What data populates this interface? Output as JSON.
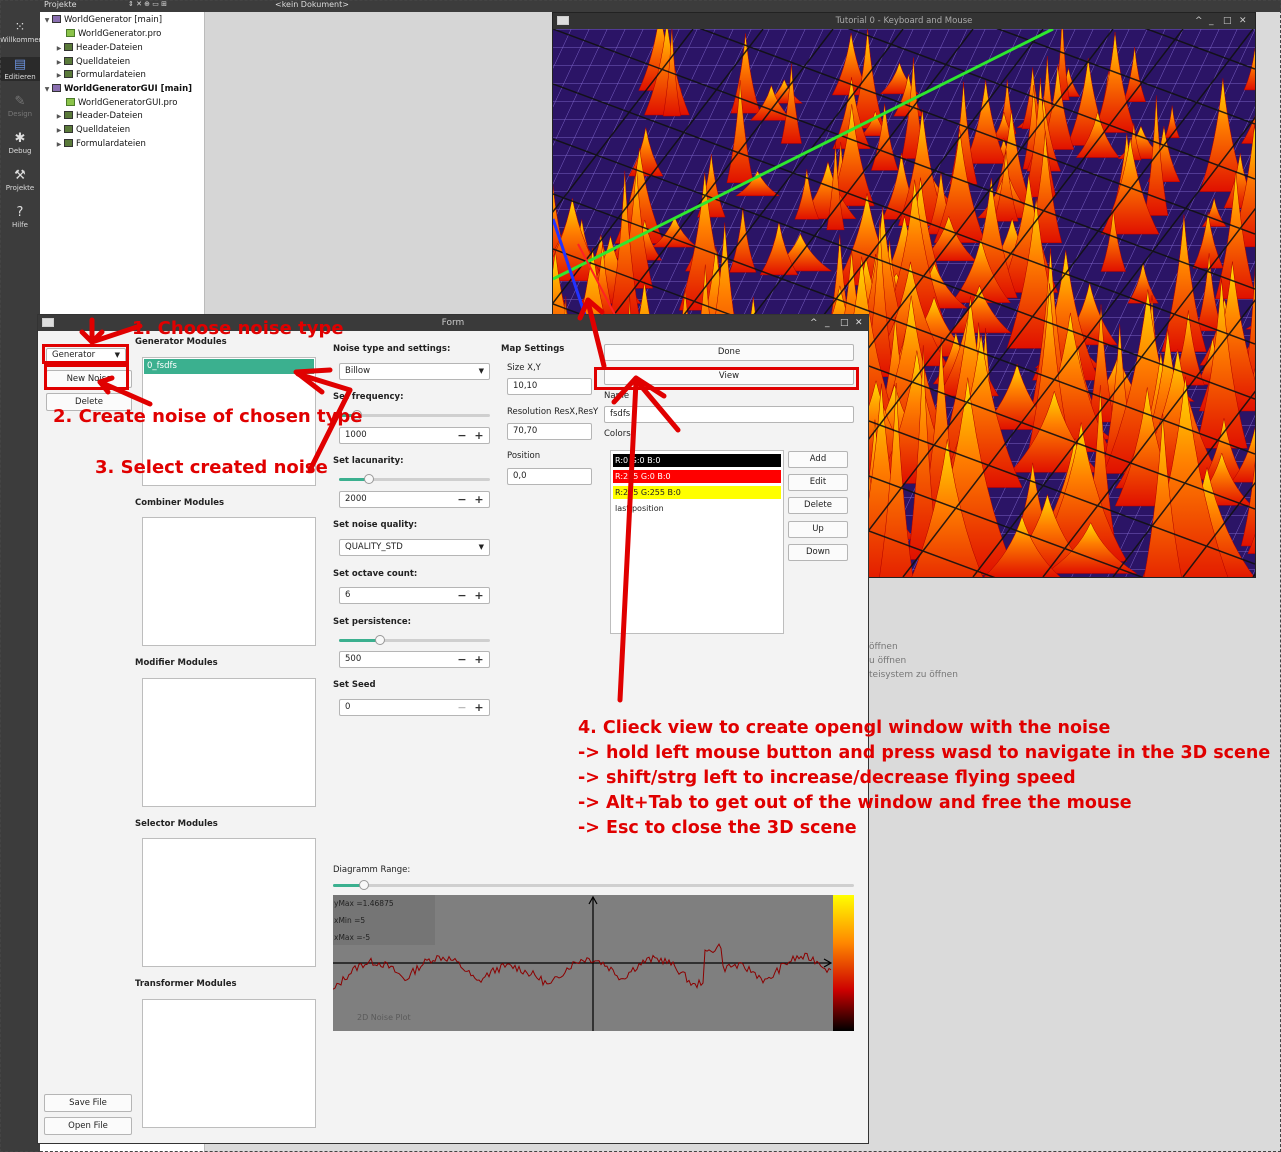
{
  "ide": {
    "topbar": {
      "projects_label": "Projekte",
      "document_label": "<kein Dokument>"
    },
    "modes": [
      {
        "icon": "grid-icon",
        "label": "Willkommen"
      },
      {
        "icon": "edit-icon",
        "label": "Editieren"
      },
      {
        "icon": "pen-icon",
        "label": "Design"
      },
      {
        "icon": "bug-icon",
        "label": "Debug"
      },
      {
        "icon": "wrench-icon",
        "label": "Projekte"
      },
      {
        "icon": "help-icon",
        "label": "Hilfe"
      }
    ],
    "tree": [
      {
        "text": "WorldGenerator [main]",
        "level": 0,
        "bold": false,
        "kind": "root"
      },
      {
        "text": "WorldGenerator.pro",
        "level": 1,
        "kind": "pro"
      },
      {
        "text": "Header-Dateien",
        "level": 1,
        "kind": "folder"
      },
      {
        "text": "Quelldateien",
        "level": 1,
        "kind": "folder"
      },
      {
        "text": "Formulardateien",
        "level": 1,
        "kind": "folder"
      },
      {
        "text": "WorldGeneratorGUI [main]",
        "level": 0,
        "bold": true,
        "kind": "root"
      },
      {
        "text": "WorldGeneratorGUI.pro",
        "level": 1,
        "kind": "pro"
      },
      {
        "text": "Header-Dateien",
        "level": 1,
        "kind": "folder"
      },
      {
        "text": "Quelldateien",
        "level": 1,
        "kind": "folder"
      },
      {
        "text": "Formulardateien",
        "level": 1,
        "kind": "folder"
      }
    ],
    "hints": [
      "öffnen",
      "u öffnen",
      "teisystem zu öffnen"
    ]
  },
  "gl_window": {
    "title": "Tutorial 0 - Keyboard and Mouse"
  },
  "form": {
    "title": "Form",
    "type_combo": "Generator",
    "new_noise": "New Noise",
    "delete": "Delete",
    "save_file": "Save File",
    "open_file": "Open File",
    "generator_modules": "Generator Modules",
    "generator_items": [
      "0_fsdfs"
    ],
    "combiner_modules": "Combiner Modules",
    "modifier_modules": "Modifier Modules",
    "selector_modules": "Selector Modules",
    "transformer_modules": "Transformer Modules",
    "noise_settings": "Noise type and settings:",
    "noise_type": "Billow",
    "set_frequency": "Set frequency:",
    "frequency_value": "1000",
    "frequency_level": 0.12,
    "set_lacunarity": "Set lacunarity:",
    "lacunarity_value": "2000",
    "lacunarity_level": 0.2,
    "set_quality": "Set noise quality:",
    "quality_value": "QUALITY_STD",
    "set_octave": "Set octave count:",
    "octave_value": "6",
    "set_persistence": "Set persistence:",
    "persistence_value": "500",
    "persistence_level": 0.27,
    "set_seed": "Set Seed",
    "seed_value": "0",
    "map_settings": "Map Settings",
    "size_label": "Size X,Y",
    "size_value": "10,10",
    "resolution_label": "Resolution ResX,ResY",
    "resolution_value": "70,70",
    "position_label": "Position",
    "position_value": "0,0",
    "done": "Done",
    "view": "View",
    "name_label": "Name",
    "name_value": "fsdfs",
    "colors_label": "Colors:",
    "colors": [
      {
        "text": "R:0 G:0 B:0",
        "bg": "#000000",
        "fg": "#ffffff"
      },
      {
        "text": "R:255 G:0 B:0",
        "bg": "#ff0000",
        "fg": "#ffffff"
      },
      {
        "text": "R:255 G:255 B:0",
        "bg": "#ffff00",
        "fg": "#222222"
      },
      {
        "text": "last position",
        "bg": "#ffffff",
        "fg": "#222222"
      }
    ],
    "color_buttons": [
      "Add",
      "Edit",
      "Delete",
      "Up",
      "Down"
    ],
    "diagram_range": "Diagramm Range:",
    "diagram_level": 0.06,
    "plot": {
      "ymax": "yMax =1.46875",
      "xmin": "xMin =5",
      "xmax": "xMax =-5",
      "label": "2D Noise Plot"
    }
  },
  "annotations": {
    "step1": "1. Choose noise type",
    "step2": "2. Create noise of chosen type",
    "step3": "3. Select created noise",
    "step4_lines": [
      "4. Clieck view to create opengl window with the noise",
      "-> hold left mouse button and press wasd to navigate in the 3D scene",
      "-> shift/strg left to increase/decrease flying speed",
      "-> Alt+Tab to get out of the window and free the mouse",
      "-> Esc to close the 3D scene"
    ],
    "color": "#e00000"
  }
}
